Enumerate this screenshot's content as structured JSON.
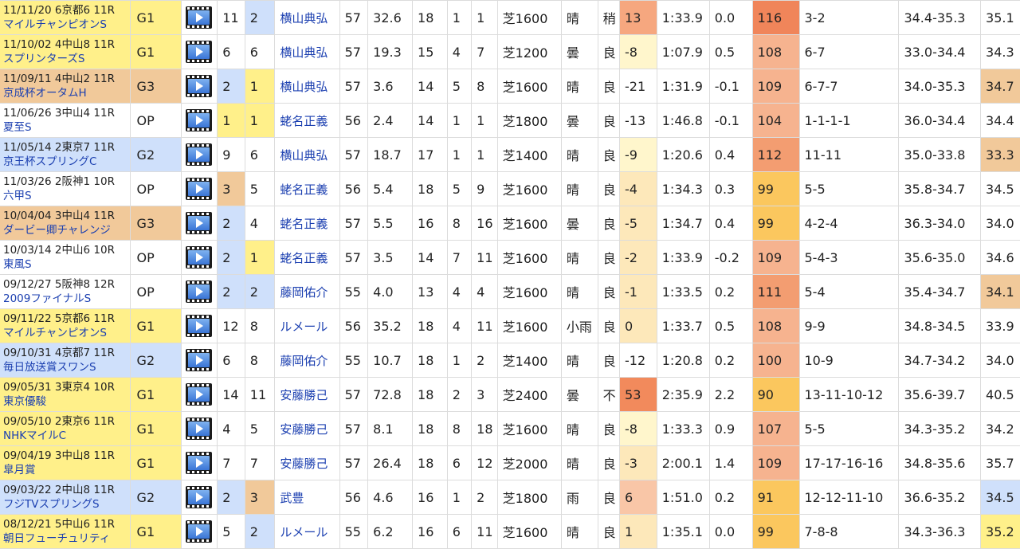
{
  "icons": {
    "video": "video-film-icon"
  },
  "colors": {
    "g1": "#fff08a",
    "g2": "#cfe0fb",
    "g3": "#f1c99a",
    "rank_top3_gold": "#fff08a",
    "rank_top3_orange": "#f1c99a",
    "speed_high": "#f0855a",
    "speed_mid": "#fbc75e",
    "link": "#1b3fb0"
  },
  "rows": [
    {
      "date": "11/11/20 6京都6 11R",
      "name": "マイルチャンピオンS",
      "grade": "G1",
      "gc": "g1",
      "gate": "11",
      "gatec": "",
      "num": "2",
      "numc": "b",
      "jockey": "横山典弘",
      "weight": "57",
      "odds": "32.6",
      "field": "18",
      "pop": "1",
      "rank": "1",
      "dist": "芝1600",
      "weather": "晴",
      "track": "稍",
      "diff": "13",
      "diffc": "h2",
      "time": "1:33.9",
      "margin": "0.0",
      "spd": "116",
      "spdc": "s3",
      "pass": "3-2",
      "pace": "34.4-35.3",
      "last3": "35.1",
      "l3c": ""
    },
    {
      "date": "11/10/02 4中山8 11R",
      "name": "スプリンターズS",
      "grade": "G1",
      "gc": "g1",
      "gate": "6",
      "gatec": "",
      "num": "6",
      "numc": "",
      "jockey": "横山典弘",
      "weight": "57",
      "odds": "19.3",
      "field": "15",
      "pop": "4",
      "rank": "7",
      "dist": "芝1200",
      "weather": "曇",
      "track": "良",
      "diff": "-8",
      "diffc": "lp",
      "time": "1:07.9",
      "margin": "0.5",
      "spd": "108",
      "spdc": "s1",
      "pass": "6-7",
      "pace": "33.0-34.4",
      "last3": "34.3",
      "l3c": ""
    },
    {
      "date": "11/09/11 4中山2 11R",
      "name": "京成杯オータムH",
      "grade": "G3",
      "gc": "g3",
      "gate": "2",
      "gatec": "b",
      "num": "1",
      "numc": "y",
      "jockey": "横山典弘",
      "weight": "57",
      "odds": "3.6",
      "field": "14",
      "pop": "5",
      "rank": "8",
      "dist": "芝1600",
      "weather": "晴",
      "track": "良",
      "diff": "-21",
      "diffc": "",
      "time": "1:31.9",
      "margin": "-0.1",
      "spd": "109",
      "spdc": "s1",
      "pass": "6-7-7",
      "pace": "34.0-35.3",
      "last3": "34.7",
      "l3c": "o"
    },
    {
      "date": "11/06/26 3中山4 11R",
      "name": "夏至S",
      "grade": "OP",
      "gc": "",
      "gate": "1",
      "gatec": "y",
      "num": "1",
      "numc": "y",
      "jockey": "蛯名正義",
      "weight": "56",
      "odds": "2.4",
      "field": "14",
      "pop": "1",
      "rank": "1",
      "dist": "芝1800",
      "weather": "曇",
      "track": "良",
      "diff": "-13",
      "diffc": "",
      "time": "1:46.8",
      "margin": "-0.1",
      "spd": "104",
      "spdc": "s1",
      "pass": "1-1-1-1",
      "pace": "36.0-34.4",
      "last3": "34.4",
      "l3c": ""
    },
    {
      "date": "11/05/14 2東京7 11R",
      "name": "京王杯スプリングC",
      "grade": "G2",
      "gc": "g2",
      "gate": "9",
      "gatec": "",
      "num": "6",
      "numc": "",
      "jockey": "横山典弘",
      "weight": "57",
      "odds": "18.7",
      "field": "17",
      "pop": "1",
      "rank": "1",
      "dist": "芝1400",
      "weather": "晴",
      "track": "良",
      "diff": "-9",
      "diffc": "lp",
      "time": "1:20.6",
      "margin": "0.4",
      "spd": "112",
      "spdc": "s2",
      "pass": "11-11",
      "pace": "35.0-33.8",
      "last3": "33.3",
      "l3c": "o"
    },
    {
      "date": "11/03/26 2阪神1 10R",
      "name": "六甲S",
      "grade": "OP",
      "gc": "",
      "gate": "3",
      "gatec": "o",
      "num": "5",
      "numc": "",
      "jockey": "蛯名正義",
      "weight": "56",
      "odds": "5.4",
      "field": "18",
      "pop": "5",
      "rank": "9",
      "dist": "芝1600",
      "weather": "晴",
      "track": "良",
      "diff": "-4",
      "diffc": "p",
      "time": "1:34.3",
      "margin": "0.3",
      "spd": "99",
      "spdc": "s0",
      "pass": "5-5",
      "pace": "35.8-34.7",
      "last3": "34.5",
      "l3c": ""
    },
    {
      "date": "10/04/04 3中山4 11R",
      "name": "ダービー卿チャレンジ",
      "grade": "G3",
      "gc": "g3",
      "gate": "2",
      "gatec": "b",
      "num": "4",
      "numc": "",
      "jockey": "蛯名正義",
      "weight": "57",
      "odds": "5.5",
      "field": "16",
      "pop": "8",
      "rank": "16",
      "dist": "芝1600",
      "weather": "曇",
      "track": "良",
      "diff": "-5",
      "diffc": "p",
      "time": "1:34.7",
      "margin": "0.4",
      "spd": "99",
      "spdc": "s0",
      "pass": "4-2-4",
      "pace": "36.3-34.0",
      "last3": "34.0",
      "l3c": ""
    },
    {
      "date": "10/03/14 2中山6 10R",
      "name": "東風S",
      "grade": "OP",
      "gc": "",
      "gate": "2",
      "gatec": "b",
      "num": "1",
      "numc": "y",
      "jockey": "蛯名正義",
      "weight": "57",
      "odds": "3.5",
      "field": "14",
      "pop": "7",
      "rank": "11",
      "dist": "芝1600",
      "weather": "晴",
      "track": "良",
      "diff": "-2",
      "diffc": "p",
      "time": "1:33.9",
      "margin": "-0.2",
      "spd": "109",
      "spdc": "s1",
      "pass": "5-4-3",
      "pace": "35.6-35.0",
      "last3": "34.6",
      "l3c": ""
    },
    {
      "date": "09/12/27 5阪神8 12R",
      "name": "2009ファイナルS",
      "grade": "OP",
      "gc": "",
      "gate": "2",
      "gatec": "b",
      "num": "2",
      "numc": "b",
      "jockey": "藤岡佑介",
      "weight": "55",
      "odds": "4.0",
      "field": "13",
      "pop": "4",
      "rank": "4",
      "dist": "芝1600",
      "weather": "晴",
      "track": "良",
      "diff": "-1",
      "diffc": "p",
      "time": "1:33.5",
      "margin": "0.2",
      "spd": "111",
      "spdc": "s2",
      "pass": "5-4",
      "pace": "35.4-34.7",
      "last3": "34.1",
      "l3c": "o"
    },
    {
      "date": "09/11/22 5京都6 11R",
      "name": "マイルチャンピオンS",
      "grade": "G1",
      "gc": "g1",
      "gate": "12",
      "gatec": "",
      "num": "8",
      "numc": "",
      "jockey": "ルメール",
      "weight": "56",
      "odds": "35.2",
      "field": "18",
      "pop": "4",
      "rank": "11",
      "dist": "芝1600",
      "weather": "小雨",
      "track": "良",
      "diff": "0",
      "diffc": "p",
      "time": "1:33.7",
      "margin": "0.5",
      "spd": "108",
      "spdc": "s1",
      "pass": "9-9",
      "pace": "34.8-34.5",
      "last3": "33.9",
      "l3c": ""
    },
    {
      "date": "09/10/31 4京都7 11R",
      "name": "毎日放送賞スワンS",
      "grade": "G2",
      "gc": "g2",
      "gate": "6",
      "gatec": "",
      "num": "8",
      "numc": "",
      "jockey": "藤岡佑介",
      "weight": "55",
      "odds": "10.7",
      "field": "18",
      "pop": "1",
      "rank": "2",
      "dist": "芝1400",
      "weather": "晴",
      "track": "良",
      "diff": "-12",
      "diffc": "",
      "time": "1:20.8",
      "margin": "0.2",
      "spd": "100",
      "spdc": "s1",
      "pass": "10-9",
      "pace": "34.7-34.2",
      "last3": "34.0",
      "l3c": ""
    },
    {
      "date": "09/05/31 3東京4 10R",
      "name": "東京優駿",
      "grade": "G1",
      "gc": "g1",
      "gate": "14",
      "gatec": "",
      "num": "11",
      "numc": "",
      "jockey": "安藤勝己",
      "weight": "57",
      "odds": "72.8",
      "field": "18",
      "pop": "2",
      "rank": "3",
      "dist": "芝2400",
      "weather": "曇",
      "track": "不",
      "diff": "53",
      "diffc": "h3",
      "time": "2:35.9",
      "margin": "2.2",
      "spd": "90",
      "spdc": "s0",
      "pass": "13-11-10-12",
      "pace": "35.6-39.7",
      "last3": "40.5",
      "l3c": ""
    },
    {
      "date": "09/05/10 2東京6 11R",
      "name": "NHKマイルC",
      "grade": "G1",
      "gc": "g1",
      "gate": "4",
      "gatec": "",
      "num": "5",
      "numc": "",
      "jockey": "安藤勝己",
      "weight": "57",
      "odds": "8.1",
      "field": "18",
      "pop": "8",
      "rank": "18",
      "dist": "芝1600",
      "weather": "晴",
      "track": "良",
      "diff": "-8",
      "diffc": "lp",
      "time": "1:33.3",
      "margin": "0.9",
      "spd": "107",
      "spdc": "s1",
      "pass": "5-5",
      "pace": "34.3-35.2",
      "last3": "34.2",
      "l3c": ""
    },
    {
      "date": "09/04/19 3中山8 11R",
      "name": "皐月賞",
      "grade": "G1",
      "gc": "g1",
      "gate": "7",
      "gatec": "",
      "num": "7",
      "numc": "",
      "jockey": "安藤勝己",
      "weight": "57",
      "odds": "26.4",
      "field": "18",
      "pop": "6",
      "rank": "12",
      "dist": "芝2000",
      "weather": "晴",
      "track": "良",
      "diff": "-3",
      "diffc": "p",
      "time": "2:00.1",
      "margin": "1.4",
      "spd": "109",
      "spdc": "s1",
      "pass": "17-17-16-16",
      "pace": "34.8-35.6",
      "last3": "35.7",
      "l3c": ""
    },
    {
      "date": "09/03/22 2中山8 11R",
      "name": "フジTVスプリングS",
      "grade": "G2",
      "gc": "g2",
      "gate": "2",
      "gatec": "b",
      "num": "3",
      "numc": "o",
      "jockey": "武豊",
      "weight": "56",
      "odds": "4.6",
      "field": "16",
      "pop": "1",
      "rank": "2",
      "dist": "芝1800",
      "weather": "雨",
      "track": "良",
      "diff": "6",
      "diffc": "h1",
      "time": "1:51.0",
      "margin": "0.2",
      "spd": "91",
      "spdc": "s0",
      "pass": "12-12-11-10",
      "pace": "36.6-35.2",
      "last3": "34.5",
      "l3c": "b"
    },
    {
      "date": "08/12/21 5中山6 11R",
      "name": "朝日フューチュリティ",
      "grade": "G1",
      "gc": "g1",
      "gate": "5",
      "gatec": "",
      "num": "2",
      "numc": "b",
      "jockey": "ルメール",
      "weight": "55",
      "odds": "6.2",
      "field": "16",
      "pop": "6",
      "rank": "11",
      "dist": "芝1600",
      "weather": "晴",
      "track": "良",
      "diff": "1",
      "diffc": "p",
      "time": "1:35.1",
      "margin": "0.0",
      "spd": "99",
      "spdc": "s0",
      "pass": "7-8-8",
      "pace": "34.3-36.3",
      "last3": "35.2",
      "l3c": "y"
    }
  ]
}
